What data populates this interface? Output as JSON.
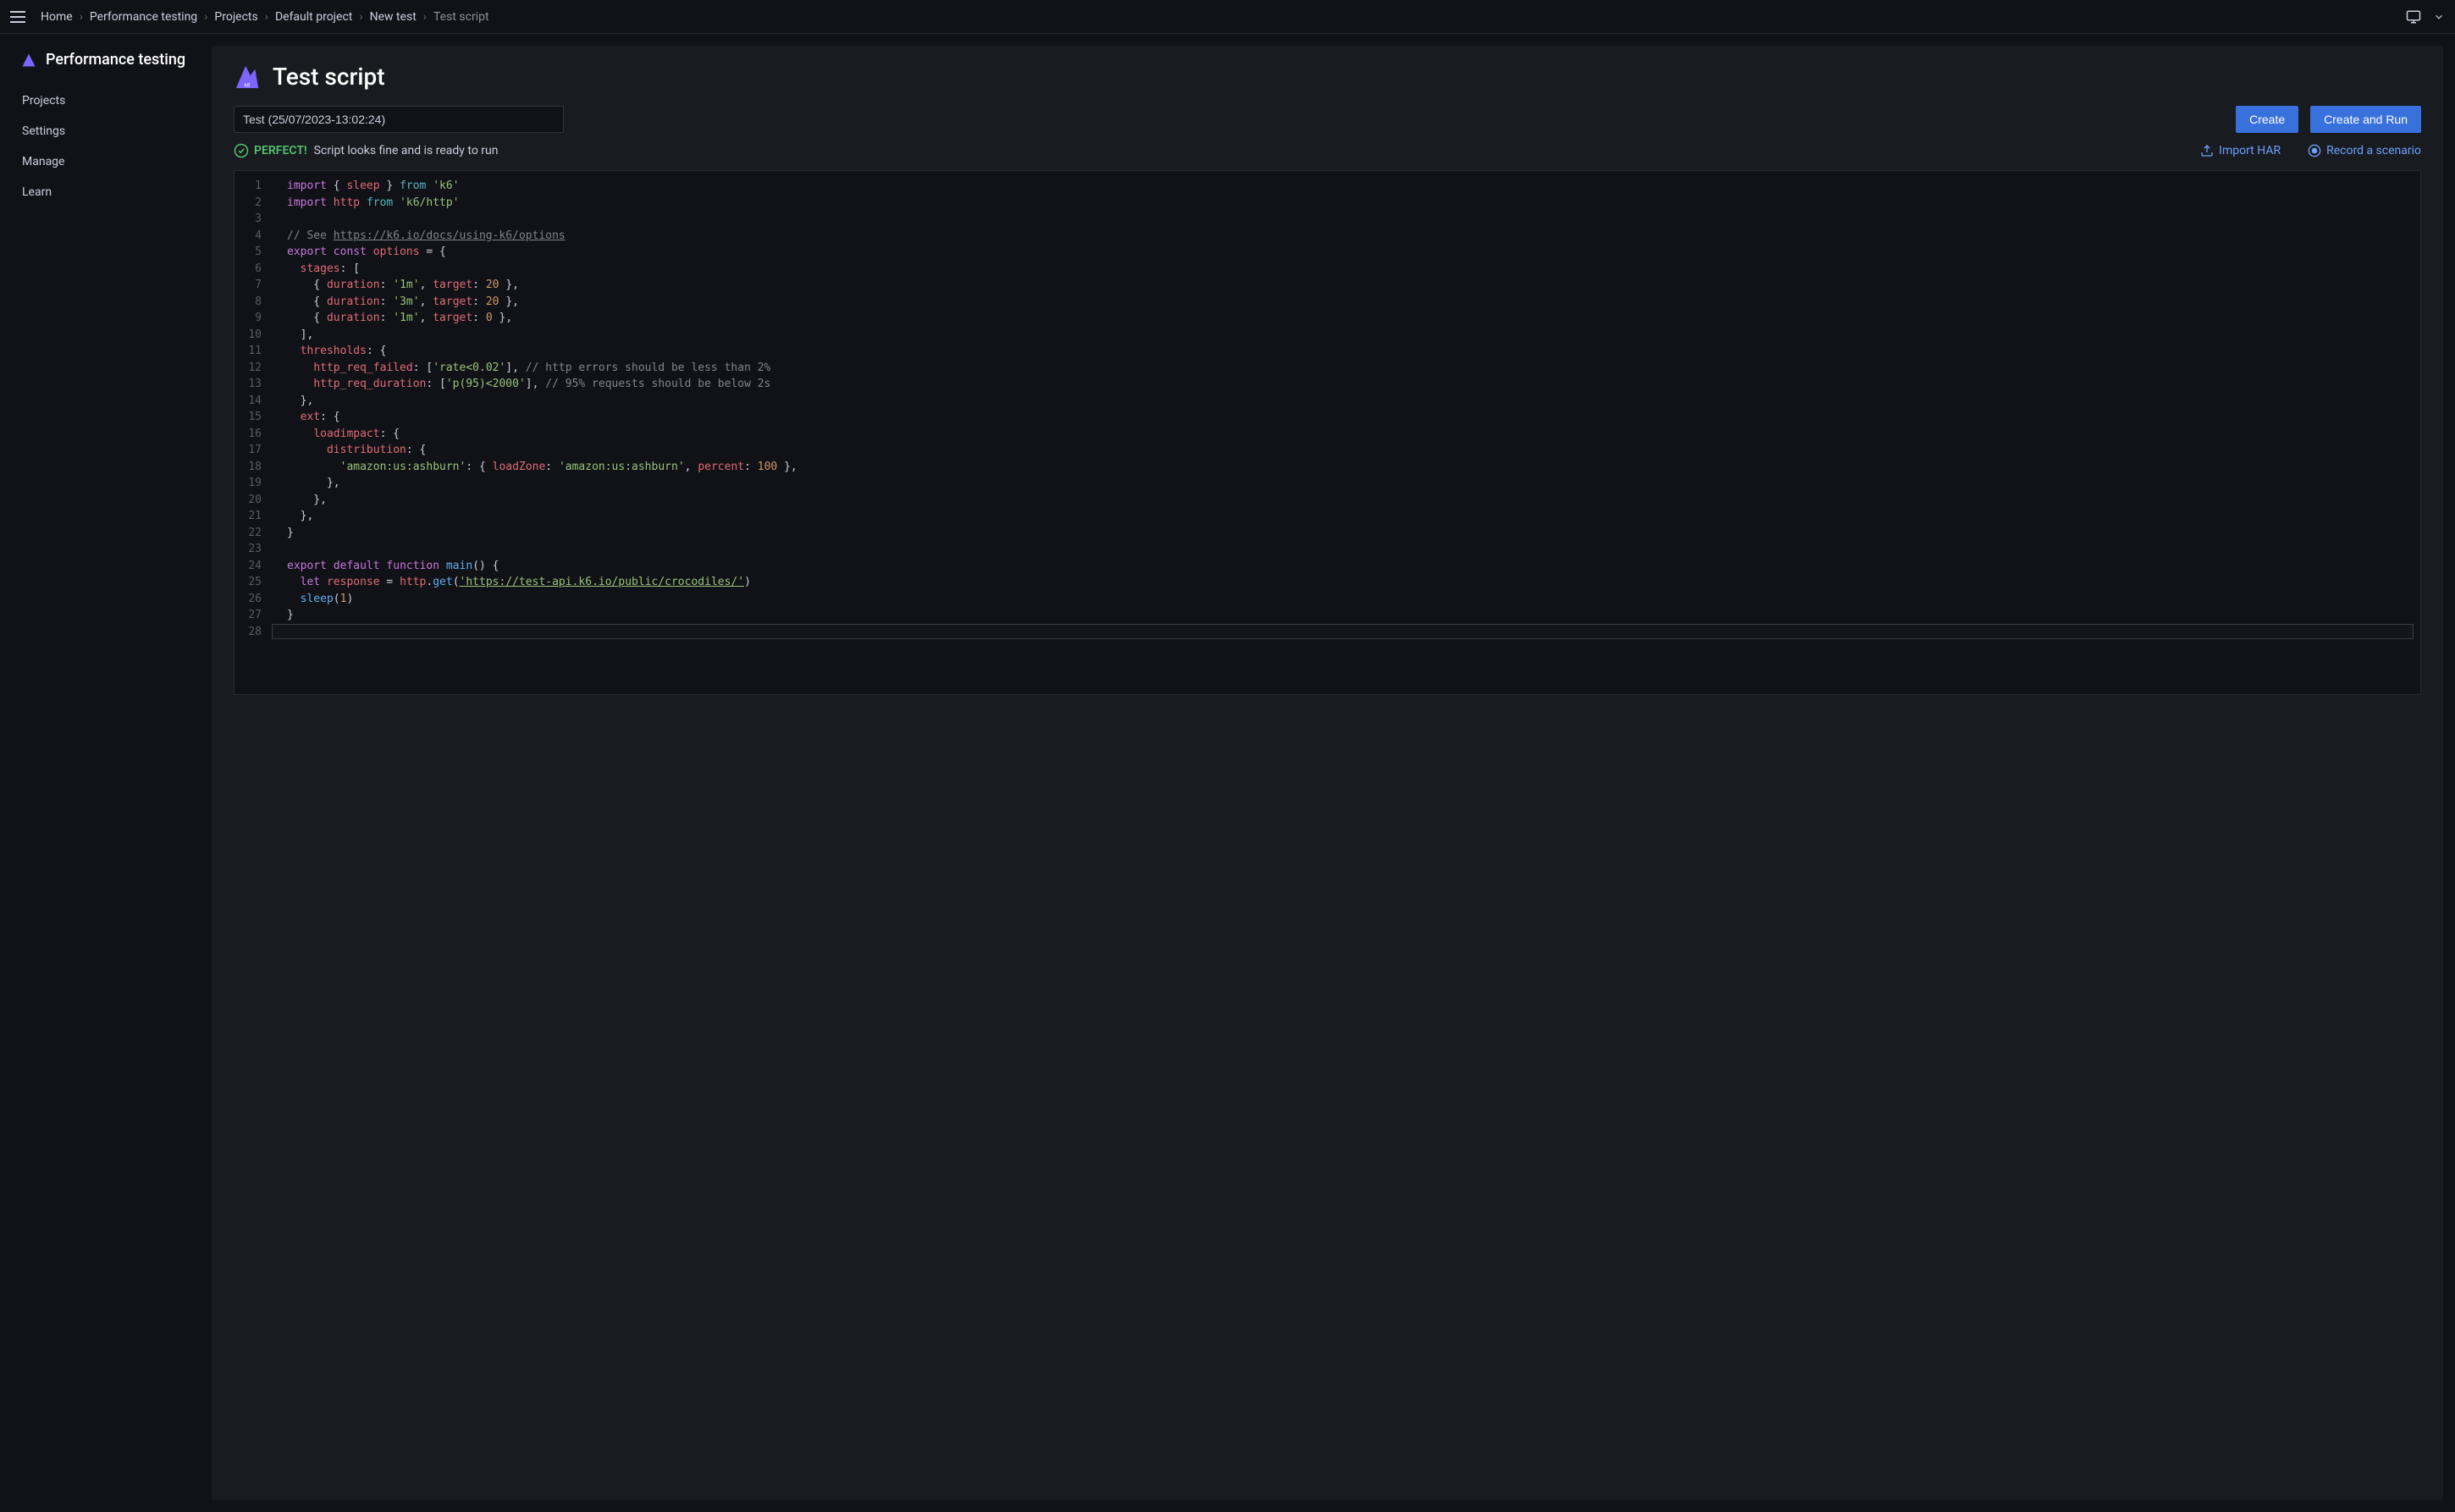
{
  "breadcrumbs": [
    "Home",
    "Performance testing",
    "Projects",
    "Default project",
    "New test",
    "Test script"
  ],
  "topbar": {
    "monitor_icon": "monitor",
    "chevron_icon": "chevron-down"
  },
  "sidebar": {
    "title": "Performance testing",
    "items": [
      "Projects",
      "Settings",
      "Manage",
      "Learn"
    ]
  },
  "page": {
    "title": "Test script",
    "test_name_value": "Test (25/07/2023-13:02:24)",
    "create_label": "Create",
    "create_run_label": "Create and Run",
    "status_ok": "PERFECT!",
    "status_msg": "Script looks fine and is ready to run",
    "import_har_label": "Import HAR",
    "record_label": "Record a scenario"
  },
  "editor": {
    "line_count": 28,
    "code_lines": [
      [
        [
          "kw",
          "import"
        ],
        [
          "",
          " { "
        ],
        [
          "ident",
          "sleep"
        ],
        [
          "",
          " } "
        ],
        [
          "kw2",
          "from"
        ],
        [
          "",
          " "
        ],
        [
          "str",
          "'k6'"
        ]
      ],
      [
        [
          "kw",
          "import"
        ],
        [
          "",
          " "
        ],
        [
          "ident",
          "http"
        ],
        [
          "",
          " "
        ],
        [
          "kw2",
          "from"
        ],
        [
          "",
          " "
        ],
        [
          "str",
          "'k6/http'"
        ]
      ],
      [],
      [
        [
          "cmt",
          "// See "
        ],
        [
          "link",
          "https://k6.io/docs/using-k6/options"
        ]
      ],
      [
        [
          "kw",
          "export"
        ],
        [
          "",
          " "
        ],
        [
          "kw",
          "const"
        ],
        [
          "",
          " "
        ],
        [
          "ident",
          "options"
        ],
        [
          "",
          " = {"
        ]
      ],
      [
        [
          "",
          "  "
        ],
        [
          "prop",
          "stages"
        ],
        [
          "",
          ": ["
        ]
      ],
      [
        [
          "",
          "    { "
        ],
        [
          "prop",
          "duration"
        ],
        [
          "",
          ": "
        ],
        [
          "str",
          "'1m'"
        ],
        [
          "",
          ", "
        ],
        [
          "prop",
          "target"
        ],
        [
          "",
          ": "
        ],
        [
          "num",
          "20"
        ],
        [
          "",
          " },"
        ]
      ],
      [
        [
          "",
          "    { "
        ],
        [
          "prop",
          "duration"
        ],
        [
          "",
          ": "
        ],
        [
          "str",
          "'3m'"
        ],
        [
          "",
          ", "
        ],
        [
          "prop",
          "target"
        ],
        [
          "",
          ": "
        ],
        [
          "num",
          "20"
        ],
        [
          "",
          " },"
        ]
      ],
      [
        [
          "",
          "    { "
        ],
        [
          "prop",
          "duration"
        ],
        [
          "",
          ": "
        ],
        [
          "str",
          "'1m'"
        ],
        [
          "",
          ", "
        ],
        [
          "prop",
          "target"
        ],
        [
          "",
          ": "
        ],
        [
          "num",
          "0"
        ],
        [
          "",
          " },"
        ]
      ],
      [
        [
          "",
          "  ],"
        ]
      ],
      [
        [
          "",
          "  "
        ],
        [
          "prop",
          "thresholds"
        ],
        [
          "",
          ": {"
        ]
      ],
      [
        [
          "",
          "    "
        ],
        [
          "prop",
          "http_req_failed"
        ],
        [
          "",
          ": ["
        ],
        [
          "str",
          "'rate<0.02'"
        ],
        [
          "",
          "], "
        ],
        [
          "cmt",
          "// http errors should be less than 2%"
        ]
      ],
      [
        [
          "",
          "    "
        ],
        [
          "prop",
          "http_req_duration"
        ],
        [
          "",
          ": ["
        ],
        [
          "str",
          "'p(95)<2000'"
        ],
        [
          "",
          "], "
        ],
        [
          "cmt",
          "// 95% requests should be below 2s"
        ]
      ],
      [
        [
          "",
          "  },"
        ]
      ],
      [
        [
          "",
          "  "
        ],
        [
          "prop",
          "ext"
        ],
        [
          "",
          ": {"
        ]
      ],
      [
        [
          "",
          "    "
        ],
        [
          "prop",
          "loadimpact"
        ],
        [
          "",
          ": {"
        ]
      ],
      [
        [
          "",
          "      "
        ],
        [
          "prop",
          "distribution"
        ],
        [
          "",
          ": {"
        ]
      ],
      [
        [
          "",
          "        "
        ],
        [
          "str",
          "'amazon:us:ashburn'"
        ],
        [
          "",
          ": { "
        ],
        [
          "prop",
          "loadZone"
        ],
        [
          "",
          ": "
        ],
        [
          "str",
          "'amazon:us:ashburn'"
        ],
        [
          "",
          ", "
        ],
        [
          "prop",
          "percent"
        ],
        [
          "",
          ": "
        ],
        [
          "num",
          "100"
        ],
        [
          "",
          " },"
        ]
      ],
      [
        [
          "",
          "      },"
        ]
      ],
      [
        [
          "",
          "    },"
        ]
      ],
      [
        [
          "",
          "  },"
        ]
      ],
      [
        [
          "",
          "}"
        ]
      ],
      [],
      [
        [
          "kw",
          "export"
        ],
        [
          "",
          " "
        ],
        [
          "kw",
          "default"
        ],
        [
          "",
          " "
        ],
        [
          "kw",
          "function"
        ],
        [
          "",
          " "
        ],
        [
          "fn",
          "main"
        ],
        [
          "",
          "() {"
        ]
      ],
      [
        [
          "",
          "  "
        ],
        [
          "kw",
          "let"
        ],
        [
          "",
          " "
        ],
        [
          "ident",
          "response"
        ],
        [
          "",
          " = "
        ],
        [
          "ident",
          "http"
        ],
        [
          "",
          "."
        ],
        [
          "fn",
          "get"
        ],
        [
          "",
          "("
        ],
        [
          "strlink",
          "'https://test-api.k6.io/public/crocodiles/'"
        ],
        [
          "",
          ")"
        ]
      ],
      [
        [
          "",
          "  "
        ],
        [
          "fn",
          "sleep"
        ],
        [
          "",
          "("
        ],
        [
          "num",
          "1"
        ],
        [
          "",
          ")"
        ]
      ],
      [
        [
          "",
          "}"
        ]
      ],
      []
    ]
  }
}
